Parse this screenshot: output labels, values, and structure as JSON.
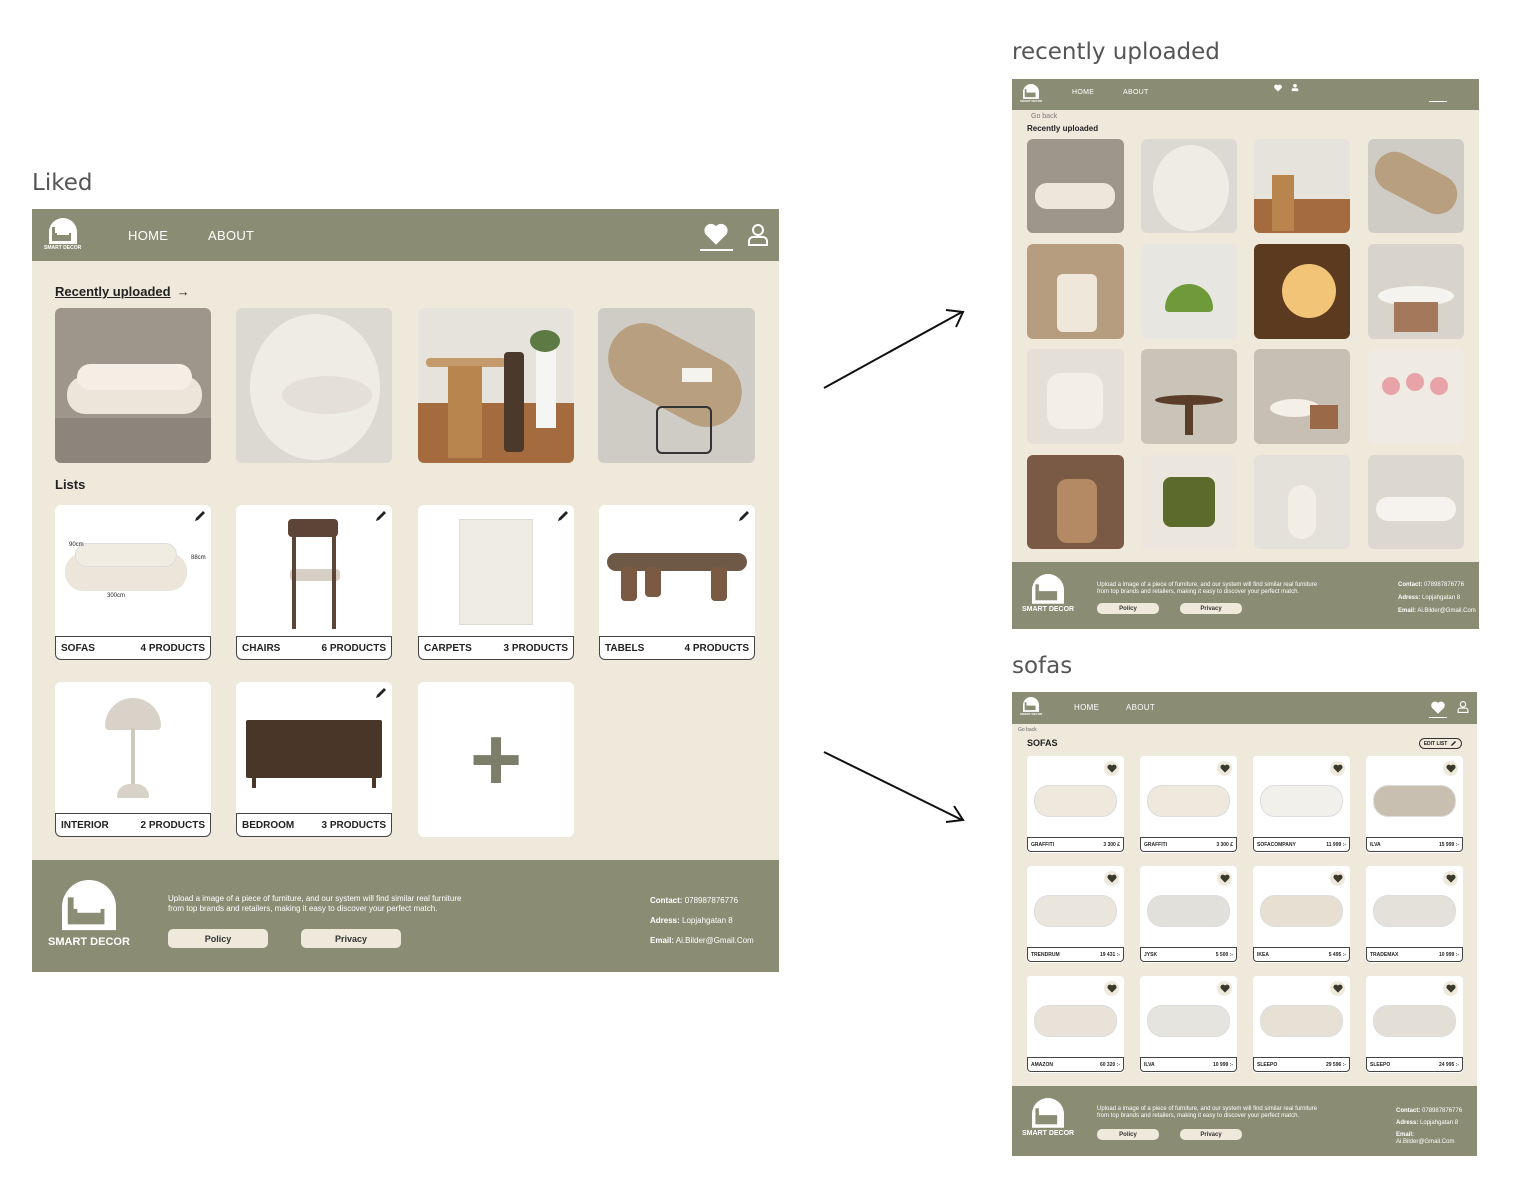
{
  "brand": "SMART DECOR",
  "nav": {
    "home": "HOME",
    "about": "ABOUT"
  },
  "footer": {
    "text_line1": "Upload a image of a piece of furniture, and our system will find similar real furniture",
    "text_line2": "from top brands and retailers, making it easy to discover your perfect match.",
    "policy": "Policy",
    "privacy": "Privacy",
    "contact_label": "Contact:",
    "contact_value": "078987876776",
    "address_label": "Adress:",
    "address_value": "Lopjahgatan 8",
    "email_label": "Email:",
    "email_value": "Ai.Bilder@Gmail.Com"
  },
  "liked": {
    "frame_label": "Liked",
    "recent_link": "Recently uploaded",
    "arrow": "→",
    "lists_title": "Lists",
    "lists": [
      {
        "name": "SOFAS",
        "count": "4 PRODUCTS"
      },
      {
        "name": "CHAIRS",
        "count": "6 PRODUCTS"
      },
      {
        "name": "CARPETS",
        "count": "3 PRODUCTS"
      },
      {
        "name": "TABELS",
        "count": "4 PRODUCTS"
      },
      {
        "name": "INTERIOR",
        "count": "2 PRODUCTS"
      },
      {
        "name": "BEDROOM",
        "count": "3 PRODUCTS"
      }
    ],
    "sofa_dims": {
      "w": "300cm",
      "d": "90cm",
      "h": "88cm"
    },
    "add_icon": "+"
  },
  "recent": {
    "frame_label": "recently uploaded",
    "go_back": "Go back",
    "title": "Recently uploaded"
  },
  "sofas": {
    "frame_label": "sofas",
    "go_back": "Go back",
    "title": "SOFAS",
    "edit_list": "EDIT LIST",
    "products": [
      {
        "brand": "GRAFFITI",
        "price": "3 300 £"
      },
      {
        "brand": "GRAFFITI",
        "price": "3 300 £"
      },
      {
        "brand": "SOFACOMPANY",
        "price": "11 999 :-"
      },
      {
        "brand": "ILVA",
        "price": "15 999 :-"
      },
      {
        "brand": "TRENDRUM",
        "price": "19 431 :-"
      },
      {
        "brand": "JYSK",
        "price": "5 500 :-"
      },
      {
        "brand": "IKEA",
        "price": "5 495 :-"
      },
      {
        "brand": "TRADEMAX",
        "price": "10 999 :-"
      },
      {
        "brand": "AMAZON",
        "price": "60 320 :-"
      },
      {
        "brand": "ILVA",
        "price": "10 999 :-"
      },
      {
        "brand": "SLEEPO",
        "price": "29 596 :-"
      },
      {
        "brand": "SLEEPO",
        "price": "24 995 :-"
      }
    ]
  },
  "colors": {
    "nav": "#8b8c74",
    "background": "#efe9dc",
    "accent_dark": "#3a3a2c"
  }
}
